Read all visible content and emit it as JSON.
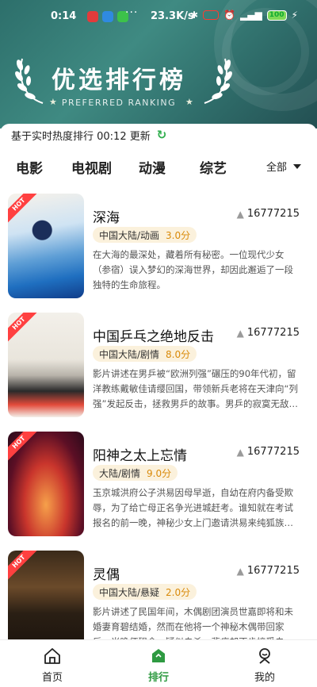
{
  "status_bar": {
    "time": "0:14",
    "speed": "23.3K/s",
    "battery": "100",
    "more": "···"
  },
  "banner": {
    "title": "优选排行榜",
    "subtitle": "PREFERRED RANKING"
  },
  "update_bar": {
    "text": "基于实时热度排行 00:12 更新"
  },
  "tabs": {
    "items": [
      "电影",
      "电视剧",
      "动漫",
      "综艺"
    ],
    "filter_label": "全部"
  },
  "list": {
    "hot_badge": "HOT",
    "items": [
      {
        "title": "深海",
        "heat": "16777215",
        "category": "中国大陆/动画",
        "rating": "3.0分",
        "desc": "在大海的最深处，藏着所有秘密。一位现代少女（参宿）误入梦幻的深海世界，却因此邂逅了一段独特的生命旅程。"
      },
      {
        "title": "中国乒乓之绝地反击",
        "heat": "16777215",
        "category": "中国大陆/剧情",
        "rating": "8.0分",
        "desc": "影片讲述在男乒被“欧洲列强”碾压的90年代初，留洋教练戴敏佳请缨回国，带领新兵老将在天津向“列强”发起反击，拯救男乒的故事。男乒的寂寞无敌，在那传奇一…"
      },
      {
        "title": "阳神之太上忘情",
        "heat": "16777215",
        "category": "大陆/剧情",
        "rating": "9.0分",
        "desc": "玉京城洪府公子洪易因母早逝，自幼在府内备受欺辱，为了给亡母正名争光进城赶考。谁知就在考试报名的前一晚，神秘少女上门邀请洪易来纯狐族教书，洪…"
      },
      {
        "title": "灵偶",
        "heat": "16777215",
        "category": "中国大陆/悬疑",
        "rating": "2.0分",
        "desc": "影片讲述了民国年间，木偶剧团演员世嘉即将和未婚妻育碧结婚，然而在他将一个神秘木偶带回家后，当晚便殒命，疑似自杀。悲痛却不肯接受自杀结案的育碧，以…"
      }
    ]
  },
  "bottom_nav": {
    "home": "首页",
    "rank": "排行",
    "mine": "我的"
  },
  "colors": {
    "accent": "#2e9a41",
    "rating": "#d98a0a",
    "tag_bg": "#fbf1dc",
    "hot_badge": "#ff4040"
  }
}
